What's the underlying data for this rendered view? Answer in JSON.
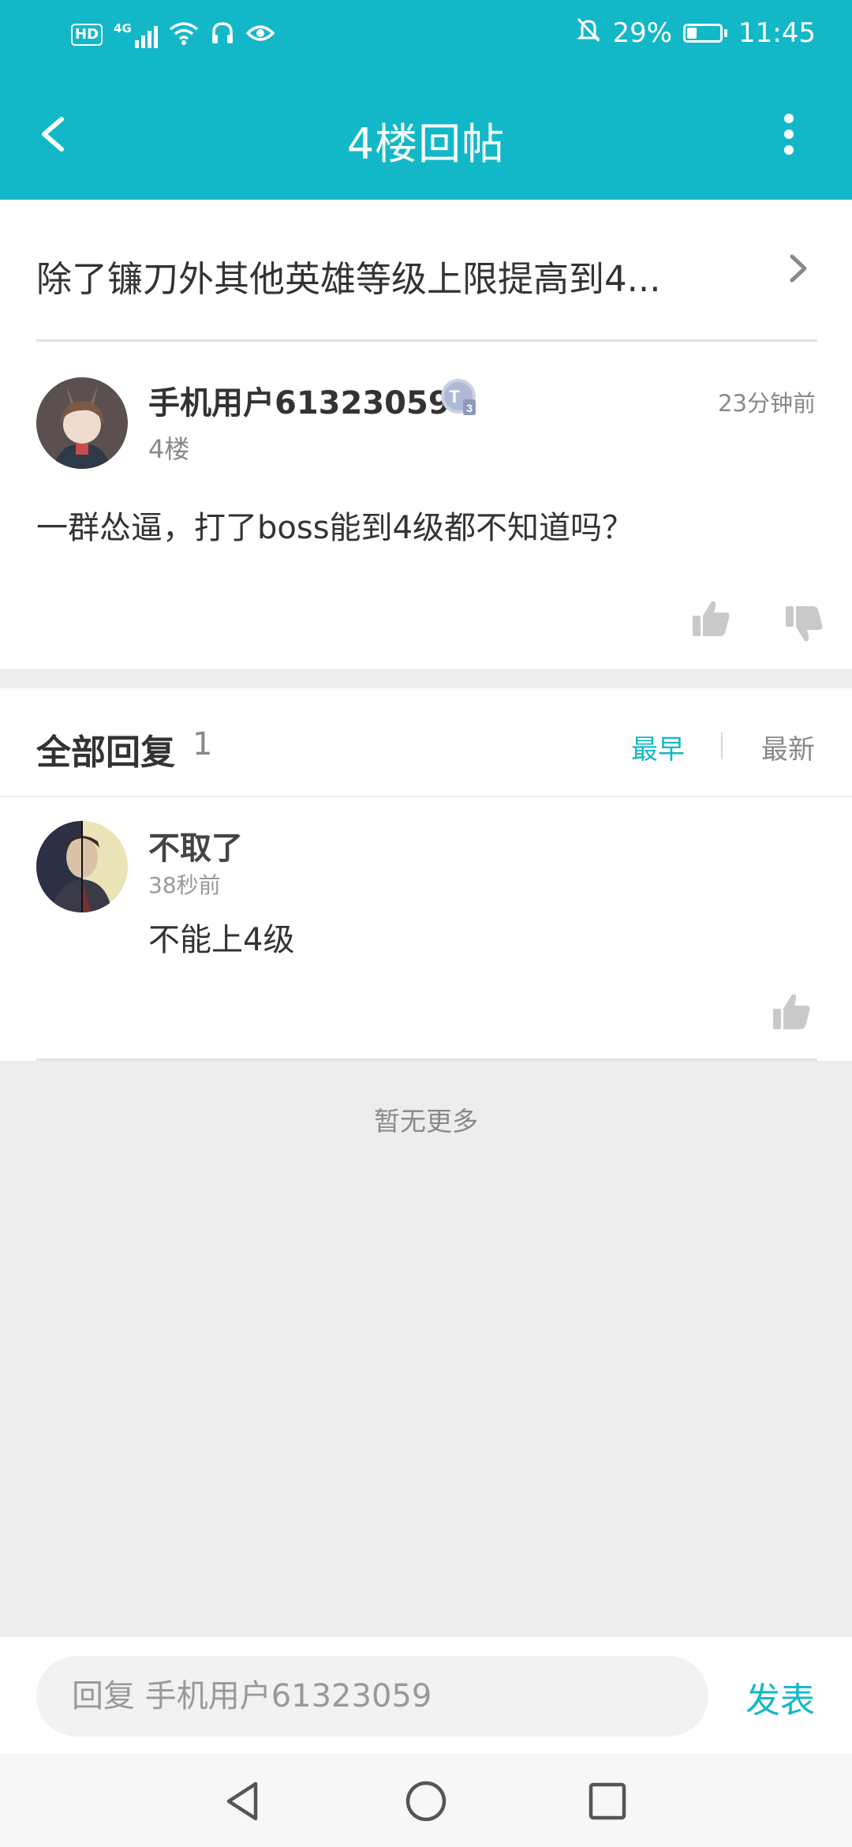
{
  "status_bar": {
    "hd": "HD",
    "network": "4G",
    "battery_percent": "29%",
    "battery_level": 0.29,
    "time": "11:45"
  },
  "header": {
    "title": "4楼回帖",
    "icons": {
      "back": "back-arrow-icon",
      "more": "more-vertical-icon"
    }
  },
  "thread": {
    "title": "除了镰刀外其他英雄等级上限提高到4..."
  },
  "post": {
    "username": "手机用户61323059",
    "badge": "T",
    "badge_level": "3",
    "time": "23分钟前",
    "floor": "4楼",
    "content": "一群怂逼，打了boss能到4级都不知道吗？"
  },
  "replies": {
    "title": "全部回复",
    "count": "1",
    "sort_earliest": "最早",
    "sort_newest": "最新",
    "items": [
      {
        "username": "不取了",
        "time": "38秒前",
        "content": "不能上4级"
      }
    ],
    "end_text": "暂无更多"
  },
  "composer": {
    "placeholder": "回复 手机用户61323059",
    "submit": "发表"
  },
  "colors": {
    "accent": "#13b8c8",
    "background": "#ededed"
  }
}
